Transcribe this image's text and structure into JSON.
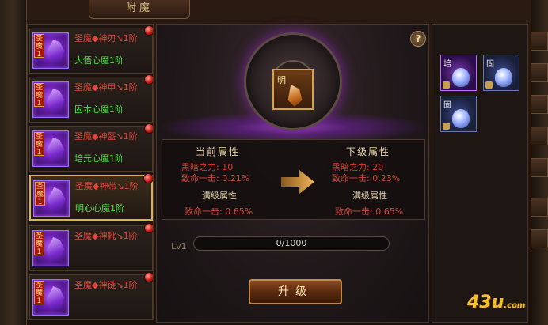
{
  "window": {
    "title": "附魔"
  },
  "items": [
    {
      "tag": "圣魔1",
      "name": "圣魔◆神刃↘1阶",
      "sub": "大悟心魔1阶",
      "selected": false
    },
    {
      "tag": "圣魔1",
      "name": "圣魔◆神甲↘1阶",
      "sub": "固本心魔1阶",
      "selected": false
    },
    {
      "tag": "圣魔1",
      "name": "圣魔◆神盔↘1阶",
      "sub": "培元心魔1阶",
      "selected": false
    },
    {
      "tag": "圣魔1",
      "name": "圣魔◆神带↘1阶",
      "sub": "明心心魔1阶",
      "selected": true
    },
    {
      "tag": "圣魔1",
      "name": "圣魔◆神靴↘1阶",
      "sub": "",
      "selected": false
    },
    {
      "tag": "圣魔1",
      "name": "圣魔◆神链↘1阶",
      "sub": "",
      "selected": false
    }
  ],
  "center": {
    "gem_tag": "明",
    "help": "?",
    "current": {
      "title": "当前属性",
      "lines": [
        "黑暗之力: 10",
        "致命一击: 0.21%"
      ],
      "max_title": "满级属性",
      "max_line": "致命一击: 0.65%"
    },
    "next": {
      "title": "下级属性",
      "lines": [
        "黑暗之力: 20",
        "致命一击: 0.23%"
      ],
      "max_title": "满级属性",
      "max_line": "致命一击: 0.65%"
    },
    "level": "Lv1",
    "progress": {
      "current": 0,
      "max": 1000,
      "text": "0/1000"
    },
    "upgrade_label": "升级"
  },
  "slots": [
    {
      "tag": "培",
      "style": "purple"
    },
    {
      "tag": "固",
      "style": "blue"
    },
    {
      "tag": "固",
      "style": "blue"
    }
  ],
  "watermark": {
    "main": "43u",
    "suffix": ".com"
  }
}
